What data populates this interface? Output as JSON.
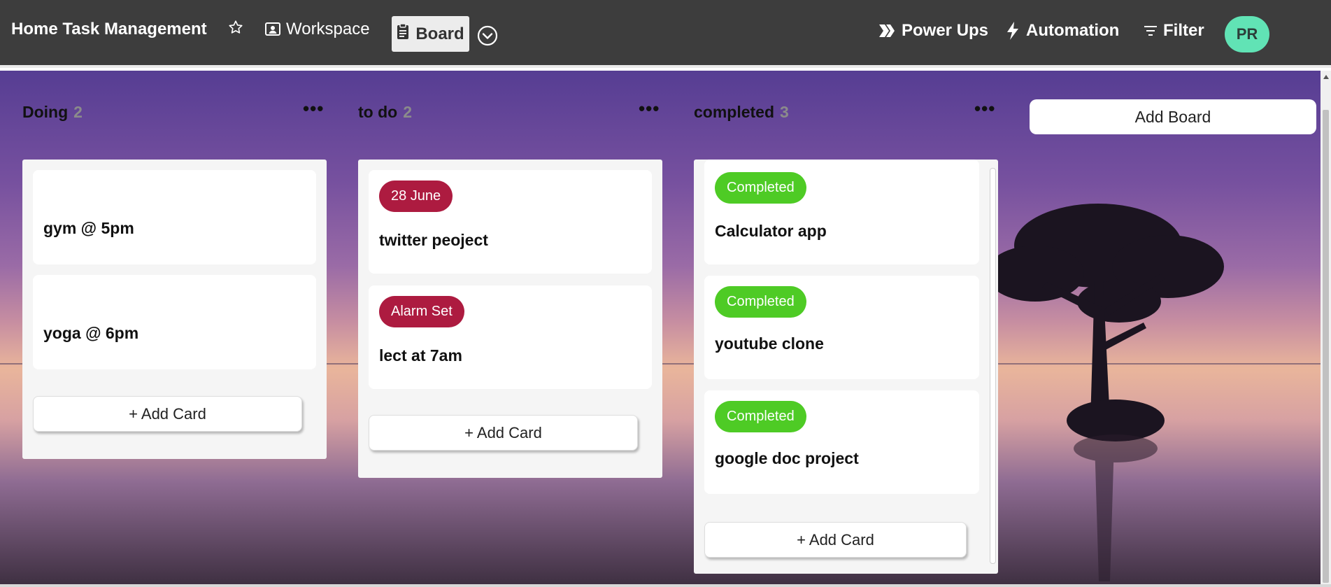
{
  "header": {
    "title": "Home Task Management",
    "workspace_label": "Workspace",
    "board_label": "Board",
    "power_ups_label": "Power Ups",
    "automation_label": "Automation",
    "filter_label": "Filter",
    "avatar_initials": "PR"
  },
  "columns": [
    {
      "title": "Doing",
      "count": "2",
      "cards": [
        {
          "title": "gym @ 5pm"
        },
        {
          "title": "yoga @ 6pm"
        }
      ],
      "add_card_label": "+ Add Card"
    },
    {
      "title": "to do",
      "count": "2",
      "cards": [
        {
          "badge": "28 June",
          "title": "twitter peoject"
        },
        {
          "badge": "Alarm Set",
          "title": "lect at 7am"
        }
      ],
      "add_card_label": "+ Add Card"
    },
    {
      "title": "completed",
      "count": "3",
      "cards": [
        {
          "badge": "Completed",
          "title": "Calculator app"
        },
        {
          "badge": "Completed",
          "title": "youtube clone"
        },
        {
          "badge": "Completed",
          "title": "google doc project"
        }
      ],
      "add_card_label": "+ Add Card"
    }
  ],
  "add_board_label": "Add Board",
  "colors": {
    "topbar": "#3d3d3d",
    "avatar": "#61e3b5",
    "badge_red": "#ad1b40",
    "badge_green": "#4ecb25"
  },
  "icons": [
    "star-icon",
    "workspace-icon",
    "clipboard-icon",
    "chevron-down-circle-icon",
    "power-ups-icon",
    "lightning-icon",
    "filter-icon",
    "more-options-icon",
    "tree-silhouette-icon"
  ]
}
